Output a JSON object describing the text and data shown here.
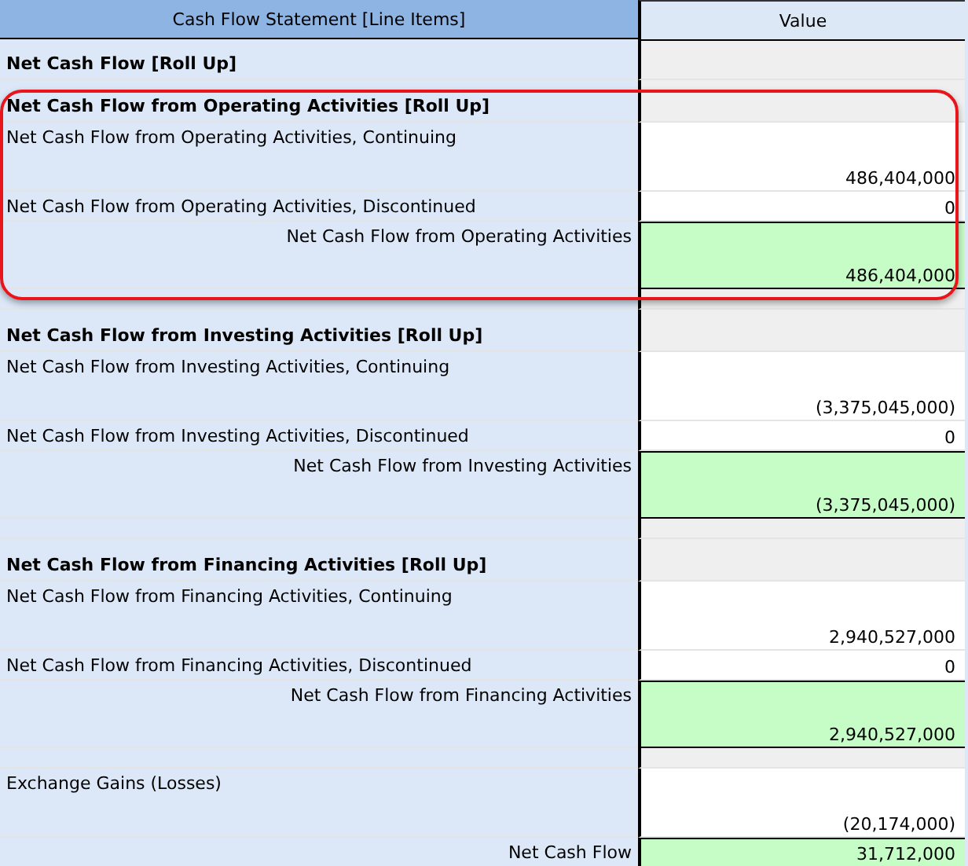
{
  "table": {
    "columns": [
      "Cash Flow Statement [Line Items]",
      "Value"
    ],
    "rows": [
      {
        "kind": "heading",
        "label": "Net Cash Flow [Roll Up]",
        "highlighted": false
      },
      {
        "kind": "rollup",
        "label": "Net Cash Flow from Operating Activities [Roll Up]",
        "highlighted": true
      },
      {
        "kind": "detail",
        "label": "Net Cash Flow from Operating Activities, Continuing",
        "value": "486,404,000",
        "highlighted": true
      },
      {
        "kind": "line",
        "label": "Net Cash Flow from Operating Activities, Discontinued",
        "value": "0",
        "highlighted": true
      },
      {
        "kind": "subtotal",
        "label": "Net Cash Flow from Operating Activities",
        "value": "486,404,000",
        "highlighted": true
      },
      {
        "kind": "rollup",
        "label": "Net Cash Flow from Investing Activities [Roll Up]",
        "highlighted": false
      },
      {
        "kind": "detail",
        "label": "Net Cash Flow from Investing Activities, Continuing",
        "value": "(3,375,045,000)",
        "highlighted": false
      },
      {
        "kind": "line",
        "label": "Net Cash Flow from Investing Activities, Discontinued",
        "value": "0",
        "highlighted": false
      },
      {
        "kind": "subtotal",
        "label": "Net Cash Flow from Investing Activities",
        "value": "(3,375,045,000)",
        "highlighted": false
      },
      {
        "kind": "rollup",
        "label": "Net Cash Flow from Financing Activities [Roll Up]",
        "highlighted": false
      },
      {
        "kind": "detail",
        "label": "Net Cash Flow from Financing Activities, Continuing",
        "value": "2,940,527,000",
        "highlighted": false
      },
      {
        "kind": "line",
        "label": "Net Cash Flow from Financing Activities, Discontinued",
        "value": "0",
        "highlighted": false
      },
      {
        "kind": "subtotal",
        "label": "Net Cash Flow from Financing Activities",
        "value": "2,940,527,000",
        "highlighted": false
      },
      {
        "kind": "detail",
        "label": "Exchange Gains (Losses)",
        "value": "(20,174,000)",
        "highlighted": false
      },
      {
        "kind": "total",
        "label": "Net Cash Flow",
        "value": "31,712,000",
        "highlighted": false
      }
    ]
  }
}
